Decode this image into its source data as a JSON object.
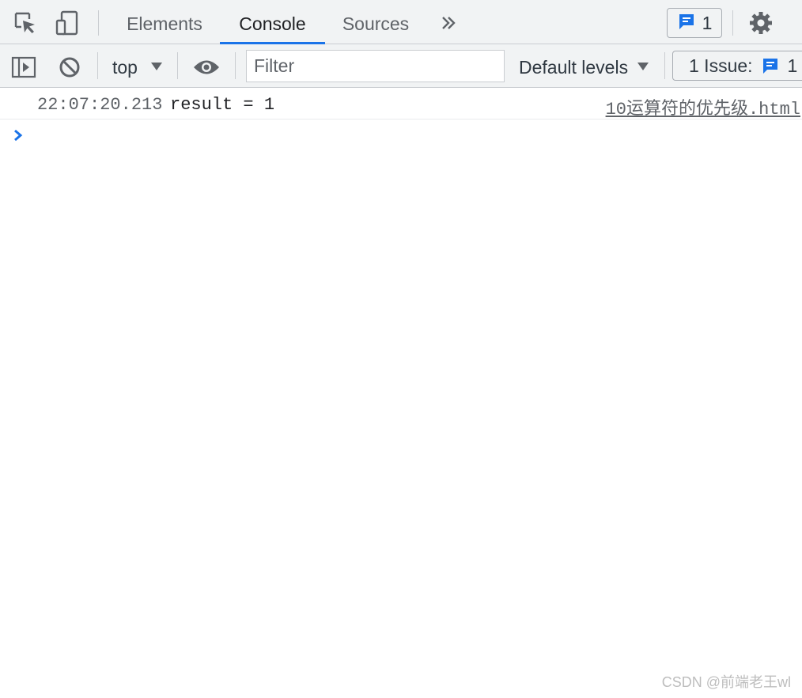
{
  "tabs": [
    {
      "label": "Elements",
      "active": false
    },
    {
      "label": "Console",
      "active": true
    },
    {
      "label": "Sources",
      "active": false
    }
  ],
  "tabbar": {
    "more_tabs_icon": "double-chevron-right-icon",
    "messages_count": "1",
    "settings_icon": "gear-icon"
  },
  "toolbar": {
    "context": "top",
    "filter_placeholder": "Filter",
    "levels": "Default levels",
    "issues_label": "1 Issue:",
    "issues_count": "1"
  },
  "console": {
    "rows": [
      {
        "timestamp": "22:07:20.213",
        "message": "result = 1",
        "source": "10运算符的优先级.html"
      }
    ]
  },
  "watermark": "CSDN @前端老王wl",
  "colors": {
    "accent": "#1a73e8",
    "toolbar_bg": "#f1f3f4"
  }
}
